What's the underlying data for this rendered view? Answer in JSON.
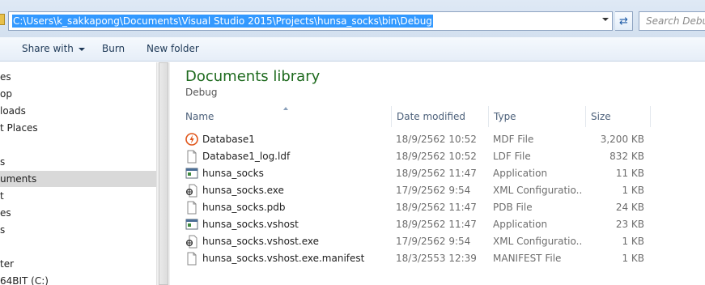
{
  "address_bar": {
    "path": "C:\\Users\\k_sakkapong\\Documents\\Visual Studio 2015\\Projects\\hunsa_socks\\bin\\Debug",
    "refresh_icon": "refresh-icon"
  },
  "search": {
    "placeholder": "Search Debug"
  },
  "toolbar": {
    "share_with": "Share with",
    "burn": "Burn",
    "new_folder": "New folder"
  },
  "sidebar": {
    "items": [
      {
        "label": "es"
      },
      {
        "label": "op"
      },
      {
        "label": "loads"
      },
      {
        "label": "t Places"
      },
      {
        "label": "s"
      },
      {
        "label": "uments"
      },
      {
        "label": "t"
      },
      {
        "label": "es"
      },
      {
        "label": "s"
      },
      {
        "label": "ter"
      },
      {
        "label": "64BIT (C:)"
      }
    ],
    "selected_index": 5
  },
  "library": {
    "title": "Documents library",
    "subtitle": "Debug"
  },
  "columns": {
    "name": "Name",
    "date": "Date modified",
    "type": "Type",
    "size": "Size"
  },
  "files": [
    {
      "name": "Database1",
      "date": "18/9/2562 10:52",
      "type": "MDF File",
      "size": "3,200 KB",
      "icon": "database-icon"
    },
    {
      "name": "Database1_log.ldf",
      "date": "18/9/2562 10:52",
      "type": "LDF File",
      "size": "832 KB",
      "icon": "document-icon"
    },
    {
      "name": "hunsa_socks",
      "date": "18/9/2562 11:47",
      "type": "Application",
      "size": "11 KB",
      "icon": "application-icon"
    },
    {
      "name": "hunsa_socks.exe",
      "date": "17/9/2562 9:54",
      "type": "XML Configuratio...",
      "size": "1 KB",
      "icon": "config-file-icon"
    },
    {
      "name": "hunsa_socks.pdb",
      "date": "18/9/2562 11:47",
      "type": "PDB File",
      "size": "24 KB",
      "icon": "document-icon"
    },
    {
      "name": "hunsa_socks.vshost",
      "date": "18/9/2562 11:47",
      "type": "Application",
      "size": "23 KB",
      "icon": "application-icon"
    },
    {
      "name": "hunsa_socks.vshost.exe",
      "date": "17/9/2562 9:54",
      "type": "XML Configuratio...",
      "size": "1 KB",
      "icon": "config-file-icon"
    },
    {
      "name": "hunsa_socks.vshost.exe.manifest",
      "date": "18/3/2553 12:39",
      "type": "MANIFEST File",
      "size": "1 KB",
      "icon": "document-icon"
    }
  ],
  "colors": {
    "selection": "#3399ff",
    "library_title": "#1e6a1e"
  }
}
